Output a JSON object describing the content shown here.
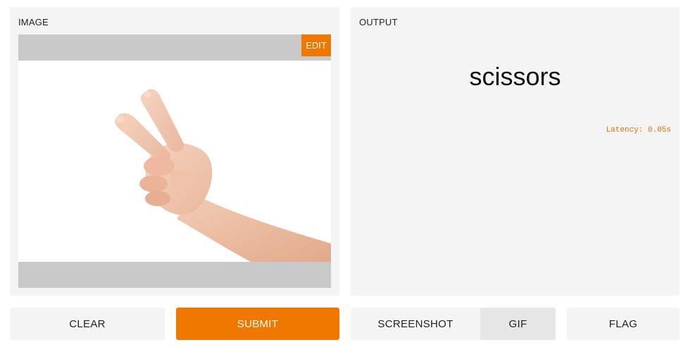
{
  "input": {
    "label": "IMAGE",
    "edit_label": "EDIT",
    "image_icon": "hand-scissors-gesture-photo"
  },
  "output": {
    "label": "OUTPUT",
    "prediction": "scissors",
    "latency": "Latency: 0.05s"
  },
  "buttons": {
    "clear": "CLEAR",
    "submit": "SUBMIT",
    "screenshot": "SCREENSHOT",
    "gif": "GIF",
    "flag": "FLAG"
  },
  "colors": {
    "accent": "#f07800",
    "panel_bg": "#f4f4f4",
    "image_frame": "#c9c9c9"
  }
}
